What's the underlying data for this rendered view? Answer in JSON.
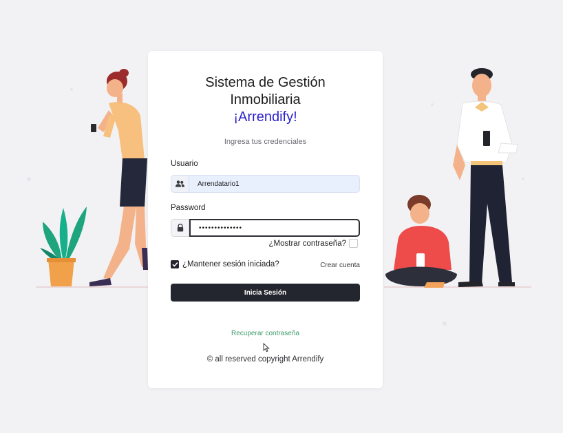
{
  "login": {
    "title_line1": "Sistema de Gestión",
    "title_line2": "Inmobiliaria",
    "brand": "¡Arrendify!",
    "subtitle": "Ingresa tus credenciales",
    "username_label": "Usuario",
    "username_value": "Arrendatario1",
    "password_label": "Password",
    "password_value": "••••••••••••••",
    "show_password_label": "¿Mostrar contraseña?",
    "remember_label": "¿Mantener sesión iniciada?",
    "create_account": "Crear cuenta",
    "submit_label": "Inicia Sesión",
    "recover_password": "Recuperar contraseña",
    "copyright": "© all reserved copyright Arrendify"
  },
  "icons": {
    "username": "users-icon",
    "password": "lock-icon",
    "checkbox_checked": "check-icon"
  },
  "colors": {
    "brand": "#2b1fcc",
    "button": "#23252f",
    "link": "#3c9a6a",
    "autofill_bg": "#e8effd"
  },
  "state": {
    "remember_checked": true,
    "show_password_checked": false
  }
}
